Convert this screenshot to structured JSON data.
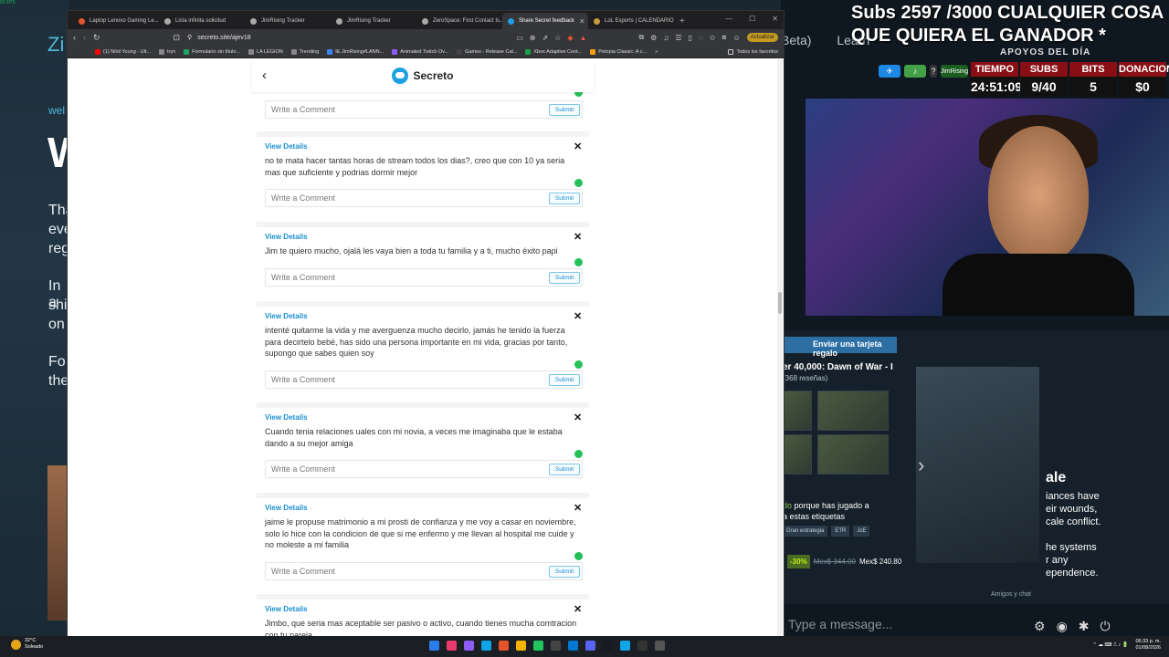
{
  "overlay": {
    "fps": "60 FPS"
  },
  "background_page": {
    "accent": "Zi",
    "eyebrow": "wel",
    "big": "W",
    "frag1": "Tha",
    "frag2": "eve",
    "frag3": "reg",
    "frag4": "In a",
    "frag5": "shi",
    "frag6": "on",
    "frag7": "Fo",
    "frag8": "the"
  },
  "browser": {
    "tabs": [
      {
        "label": "Laptop Lenovo Gaming Le...",
        "color": "#e3562f",
        "active": false
      },
      {
        "label": "Lista infinita solicitud",
        "color": "#aaaaaa",
        "active": false
      },
      {
        "label": "JimRising Tracker",
        "color": "#aaaaaa",
        "active": false
      },
      {
        "label": "JimRising Tracker",
        "color": "#aaaaaa",
        "active": false
      },
      {
        "label": "ZeroSpace: First Contact Is...",
        "color": "#aaaaaa",
        "active": false
      },
      {
        "label": "Share Secret feedback",
        "color": "#1da1e2",
        "active": true
      },
      {
        "label": "LoL Esports | CALENDARIO",
        "color": "#c89b3c",
        "active": false
      }
    ],
    "new_tab": "+",
    "url": "secreto.site/ajev18",
    "update_label": "Actualizar",
    "bookmarks": [
      {
        "label": "(1) Nihil Young - Ult...",
        "color": "#ff0000"
      },
      {
        "label": "tryn",
        "color": "#888888"
      },
      {
        "label": "Formulario sin título...",
        "color": "#1da462"
      },
      {
        "label": "LA LEGION",
        "color": "#888888"
      },
      {
        "label": "Trending",
        "color": "#888888"
      },
      {
        "label": "IE JimRising#LANN...",
        "color": "#3b82f6"
      },
      {
        "label": "Animated Twitch Ov...",
        "color": "#8b5cf6"
      },
      {
        "label": "Games - Release Cal...",
        "color": "#444444"
      },
      {
        "label": "Xbox Adaptive Cont...",
        "color": "#16a34a"
      },
      {
        "label": "Petopia Classic: A c...",
        "color": "#f59e0b"
      }
    ],
    "all_favorites": "Todos los favoritos"
  },
  "app": {
    "title": "Secreto",
    "brand_color": "#1da1e2",
    "comment_placeholder": "Write a Comment",
    "submit_label": "Submit",
    "view_details_label": "View Details",
    "close_glyph": "✕",
    "back_glyph": "‹",
    "secrets": [
      {
        "message": "no te mata hacer tantas horas de stream todos los dias?, creo que con 10 ya seria mas que suficiente y podrias dormir mejor"
      },
      {
        "message": "Jim te quiero mucho, ojalá les vaya bien a toda tu familia y a ti, mucho éxito papi"
      },
      {
        "message": "intenté quitarme la vida y me averguenza mucho decirlo, jamás he tenido la fuerza para decirtelo bebé, has sido una persona importante en mi vida, gracias por tanto, supongo que sabes quien soy"
      },
      {
        "message": "Cuando tenia relaciones uales con mi novia, a veces me imaginaba que le estaba dando a su mejor amiga"
      },
      {
        "message": "jaime le propuse matrimonio a mi prosti de confianza y me voy a casar en noviembre, solo lo hice con la condicion de que si me enfermo y me llevan al hospital me cuide y no moleste a mi familia"
      },
      {
        "message": "Jimbo, que seria mas aceptable ser pasivo o activo, cuando tienes mucha comtracion con tu pareja"
      }
    ]
  },
  "stream": {
    "banner": "Subs 2597 /3000 CUALQUIER COSA QUE QUIERA EL GANADOR *",
    "behind_left": "Beta)",
    "behind_mid": "Learn",
    "apoyos": "APOYOS DEL DÍA",
    "channel": "JimRising",
    "stats": [
      {
        "label": "TIEMPO",
        "value": "24:51:09"
      },
      {
        "label": "SUBS",
        "value": "9/40"
      },
      {
        "label": "BITS",
        "value": "5"
      },
      {
        "label": "DONACIONES",
        "value": "$0"
      }
    ],
    "steam": {
      "gift": "Enviar una tarjeta regalo",
      "game_title": "er 40,000: Dawn of War - I",
      "reviews": "(368 reseñas)",
      "played_prefix": "do",
      "played_text": "porque has jugado a",
      "played_text2": "a estas etiquetas",
      "tags": [
        "Gran estrategia",
        "ETR",
        "JcE"
      ],
      "discount": "-30%",
      "old_price": "Mex$ 344.00",
      "new_price": "Mex$ 240.80",
      "side_title": "ale",
      "side_lines": [
        "iances have",
        "eir wounds,",
        "cale conflict.",
        "",
        "he systems",
        "r any",
        "ependence."
      ],
      "friends": "Amigos y chat"
    },
    "chat_placeholder": "Type a message..."
  },
  "taskbar": {
    "temp": "32°C",
    "weather": "Soleado",
    "time": "06:33 p. m.",
    "date": "01/08/2026"
  }
}
